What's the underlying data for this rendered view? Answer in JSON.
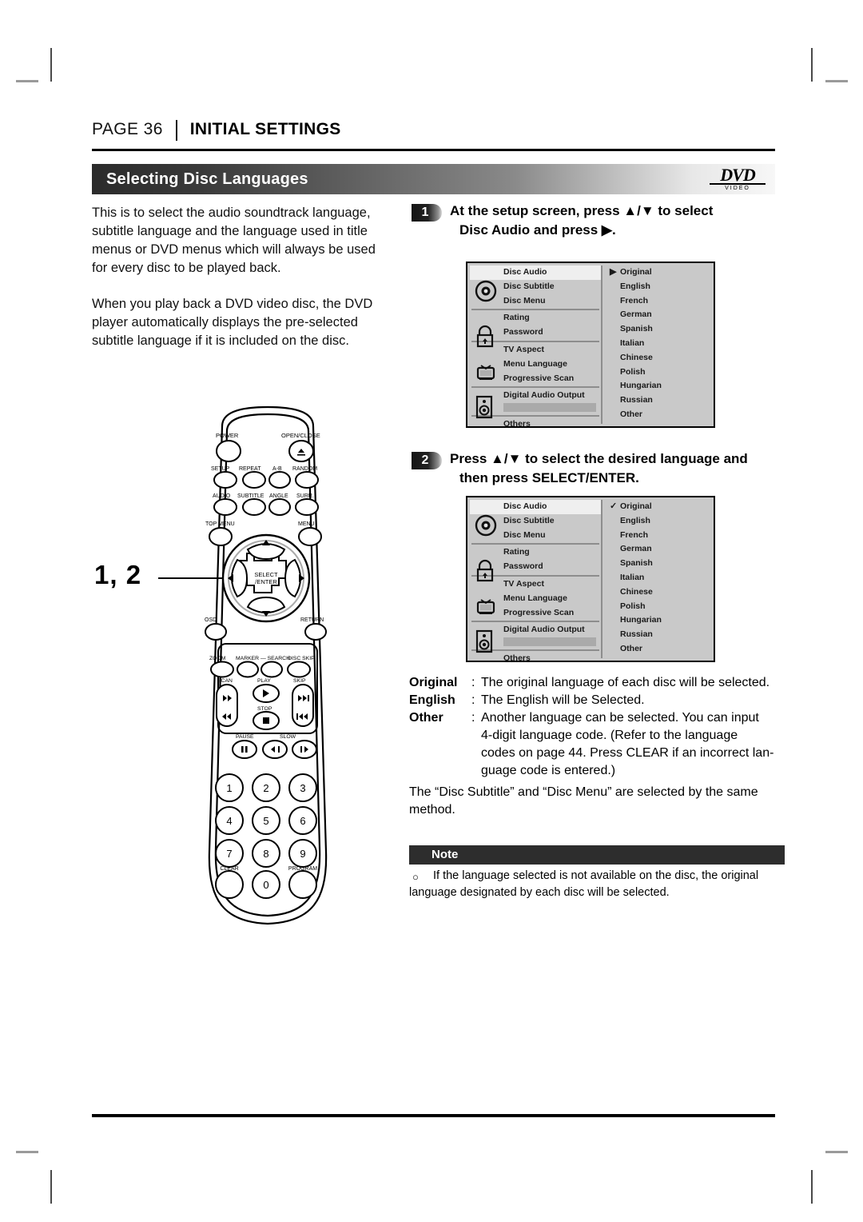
{
  "header": {
    "page_label": "PAGE 36",
    "section": "INITIAL SETTINGS"
  },
  "titlebar": {
    "title": "Selecting Disc Languages",
    "logo_word": "DVD",
    "logo_sub": "VIDEO"
  },
  "intro": {
    "paragraph1": "This is to select the audio soundtrack language, subtitle language and the language used in title menus or DVD menus which will always be used for every disc to be played back.",
    "paragraph2": "When you play back a DVD video disc, the DVD player automatically displays the pre-selected subtitle language if it is included on the disc."
  },
  "steps": [
    {
      "number": "1",
      "line1": "At the setup screen, press ▲/▼ to select",
      "line2": "Disc Audio  and press ▶."
    },
    {
      "number": "2",
      "line1": "Press ▲/▼ to select the desired language and",
      "line2": "then press SELECT/ENTER."
    }
  ],
  "setup_screen": {
    "menu_groups": [
      {
        "icon": "disc-icon",
        "items": [
          "Disc Audio",
          "Disc Subtitle",
          "Disc Menu"
        ]
      },
      {
        "icon": "lock-icon",
        "items": [
          "Rating",
          "Password"
        ]
      },
      {
        "icon": "tv-icon",
        "items": [
          "TV Aspect",
          "Menu Language",
          "Progressive Scan"
        ]
      },
      {
        "icon": "speaker-icon",
        "items": [
          "Digital Audio Output"
        ]
      }
    ],
    "footer_item": "Others",
    "selected_menu_item": "Disc Audio",
    "languages": [
      "Original",
      "English",
      "French",
      "German",
      "Spanish",
      "Italian",
      "Chinese",
      "Polish",
      "Hungarian",
      "Russian",
      "Other"
    ],
    "screen1_marker": "▶",
    "screen1_marked_language": "Original",
    "screen2_marker": "✓",
    "screen2_marked_language": "Original"
  },
  "definitions": [
    {
      "term": "Original",
      "colon": ":",
      "text": "The original language of each disc will be selected."
    },
    {
      "term": "English",
      "colon": ":",
      "text": "The English will be Selected."
    },
    {
      "term": "Other",
      "colon": ":",
      "text": "Another language can be selected. You can input"
    }
  ],
  "definition_continuation": [
    "4-digit language code. (Refer to the language",
    "codes on page 44. Press CLEAR if an incorrect lan-",
    "guage code is entered.)"
  ],
  "same_method": "The “Disc Subtitle” and “Disc Menu” are selected by the same method.",
  "note": {
    "label": "Note",
    "bullet": "○",
    "text": "If the language selected is not available on the disc, the original language designated by each disc will be selected."
  },
  "callout": {
    "label": "1, 2"
  },
  "remote": {
    "buttons": {
      "power": "POWER",
      "open_close": "OPEN/CLOSE",
      "setup": "SETUP",
      "repeat": "REPEAT",
      "ab": "A-B",
      "random": "RANDOM",
      "audio": "AUDIO",
      "subtitle": "SUBTITLE",
      "angle": "ANGLE",
      "surr": "SURR.",
      "top_menu": "TOP MENU",
      "menu": "MENU",
      "select_enter_line1": "SELECT",
      "select_enter_line2": "/ENTER",
      "osd": "OSD",
      "return": "RETURN",
      "zoom": "ZOOM",
      "marker_search": "MARKER — SEARCH",
      "disc_skip": "DISC SKIP",
      "scan": "SCAN",
      "play": "PLAY",
      "skip": "SKIP",
      "stop": "STOP",
      "pause": "PAUSE",
      "slow": "SLOW",
      "clear": "CLEAR",
      "program": "PROGRAM"
    },
    "numpad": [
      "1",
      "2",
      "3",
      "4",
      "5",
      "6",
      "7",
      "8",
      "9",
      "0"
    ]
  }
}
